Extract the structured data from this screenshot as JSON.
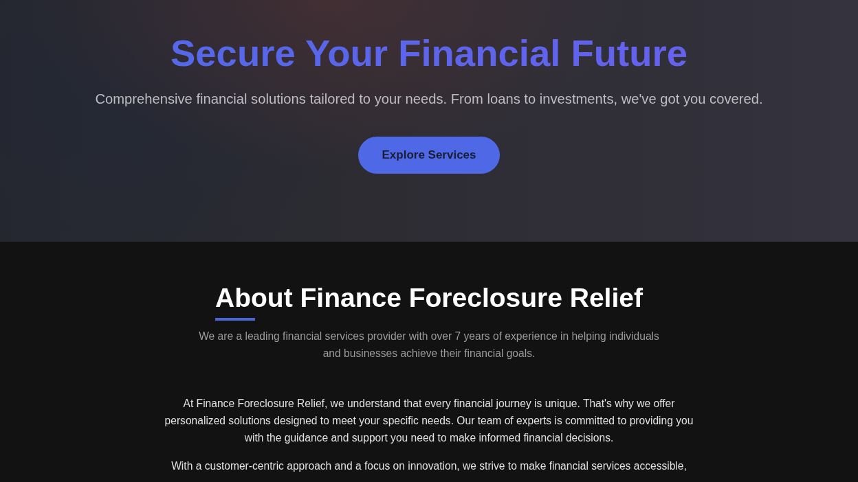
{
  "hero": {
    "title": "Secure Your Financial Future",
    "subtitle": "Comprehensive financial solutions tailored to your needs. From loans to investments, we've got you covered.",
    "button": "Explore Services"
  },
  "about": {
    "heading": "About Finance Foreclosure Relief",
    "intro": "We are a leading financial services provider with over 7 years of experience in helping individuals and businesses achieve their financial goals.",
    "paragraphs": [
      "At Finance Foreclosure Relief, we understand that every financial journey is unique. That's why we offer personalized solutions designed to meet your specific needs. Our team of experts is committed to providing you with the guidance and support you need to make informed financial decisions.",
      "With a customer-centric approach and a focus on innovation, we strive to make financial services accessible,"
    ]
  }
}
